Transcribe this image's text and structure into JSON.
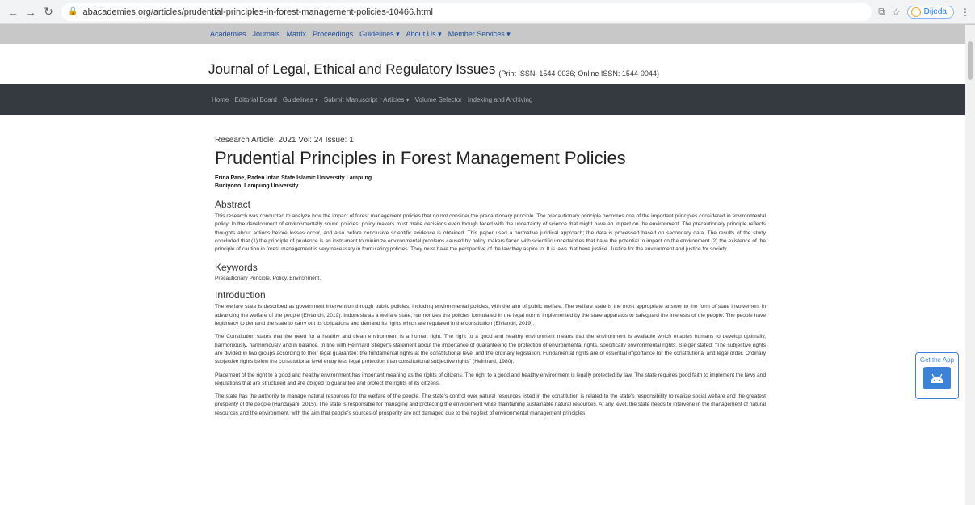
{
  "browser": {
    "url": "abacademies.org/articles/prudential-principles-in-forest-management-policies-10466.html",
    "profile_name": "Dijeda"
  },
  "top_nav": {
    "items": [
      "Academies",
      "Journals",
      "Matrix",
      "Proceedings",
      "Guidelines ▾",
      "About Us ▾",
      "Member Services ▾"
    ]
  },
  "header": {
    "journal_title": "Journal of Legal, Ethical and Regulatory Issues",
    "issn": "(Print ISSN: 1544-0036; Online ISSN: 1544-0044)"
  },
  "main_nav": {
    "items": [
      "Home",
      "Editorial Board",
      "Guidelines ▾",
      "Submit Manuscript",
      "Articles ▾",
      "Volume Selector",
      "Indexing and Archiving"
    ]
  },
  "article": {
    "meta": "Research Article: 2021 Vol: 24 Issue: 1",
    "title": "Prudential Principles in Forest Management Policies",
    "author1": "Erina Pane, Raden Intan State Islamic University Lampung",
    "author2": "Budiyono, Lampung University",
    "abstract_heading": "Abstract",
    "abstract": "This research was conducted to analyze how the impact of forest management policies that do not consider the precautionary principle. The precautionary principle becomes one of the important principles considered in environmental policy. In the development of environmentally sound policies, policy makers must make decisions even though faced with the uncertainty of science that might have an impact on the environment. The precautionary principle reflects thoughts about actions before losses occur, and also before conclusive scientific evidence is obtained. This paper used a normative juridical approach; the data is processed based on secondary data. The results of the study concluded that (1) the principle of prudence is an instrument to minimize environmental problems caused by policy makers faced with scientific uncertainties that have the potential to impact on the environment (2) the existence of the principle of caution in forest management is very necessary in formulating policies. They must have the perspective of the law they aspire to. It is laws that have justice. Justice for the environment and justice for society.",
    "keywords_heading": "Keywords",
    "keywords": "Precautionary Principle, Policy, Environment.",
    "intro_heading": "Introduction",
    "intro_p1": "The welfare state is described as government intervention through public policies, including environmental policies, with the aim of public welfare. The welfare state is the most appropriate answer to the form of state involvement in advancing the welfare of the people (Elviandri, 2019). Indonesia as a welfare state, harmonizes the policies formulated in the legal norms implemented by the state apparatus to safeguard the interests of the people. The people have legitimacy to demand the state to carry out its obligations and demand its rights which are regulated in the constitution (Elviandri, 2019).",
    "intro_p2": "The Constitution states that the need for a healthy and clean environment is a human right. The right to a good and healthy environment means that the environment is available which enables humans to develop optimally, harmoniously, harmoniously and in balance. In line with Heinhard Stieger's statement about the importance of guaranteeing the protection of environmental rights, specifically environmental rights. Steiger stated: \"The subjective rights are divided in two groups according to their legal guarantee: the fundamental rights at the constitutional level and the ordinary legislation. Fundamental rights are of essential importance for the constitutional and legal order. Ordinary subjective rights below the constitutional level enjoy less legal protection than constitutional subjective rights\" (Heinhard, 1980).",
    "intro_p3": "Placement of the right to a good and healthy environment has important meaning as the rights of citizens. The right to a good and healthy environment is legally protected by law. The state requires good faith to implement the laws and regulations that are structured and are obliged to guarantee and protect the rights of its citizens.",
    "intro_p4": "The state has the authority to manage natural resources for the welfare of the people. The state's control over natural resources listed in the constitution is related to the state's responsibility to realize social welfare and the greatest prosperity of the people (Handayani, 2015). The state is responsible for managing and protecting the environment while maintaining sustainable natural resources. At any level, the state needs to intervene in the management of natural resources and the environment, with the aim that people's sources of prosperity are not damaged due to the neglect of environmental management principles."
  },
  "app_widget": {
    "label": "Get the App"
  }
}
